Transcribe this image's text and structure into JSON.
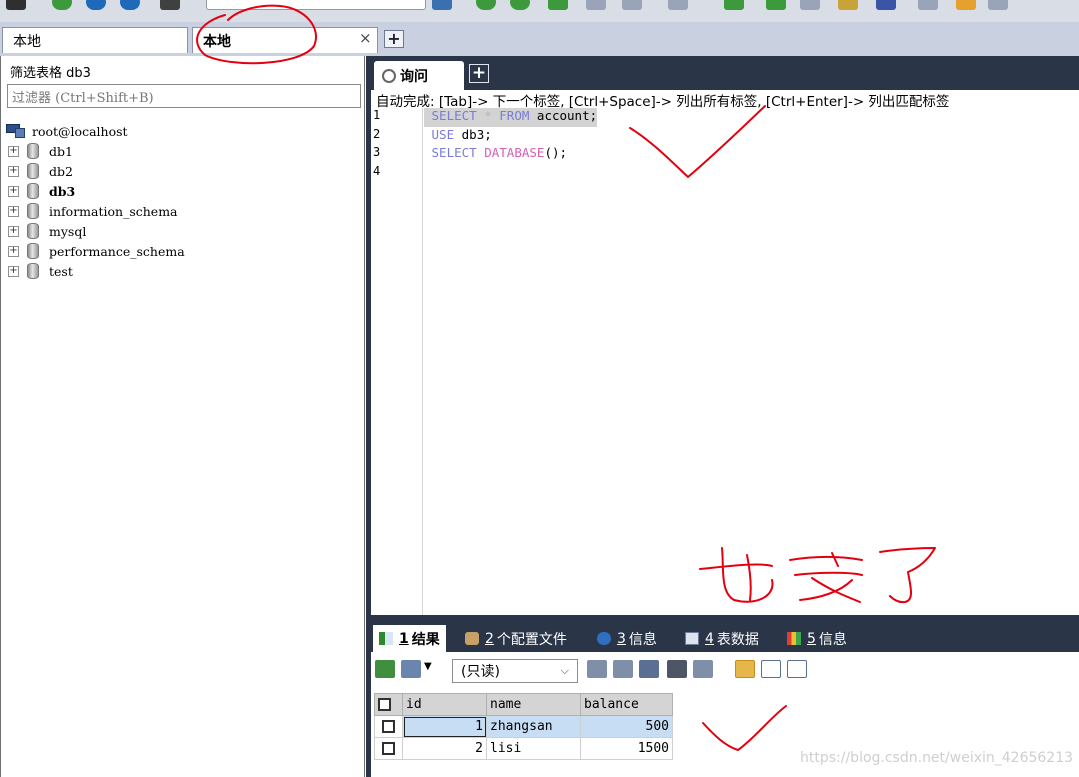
{
  "conn_tabs": [
    {
      "label": "本地"
    },
    {
      "label": "本地"
    }
  ],
  "tab_close": "×",
  "tab_add": "+",
  "left_panel": {
    "filter_title": "筛选表格 db3",
    "filter_placeholder": "过滤器 (Ctrl+Shift+B)",
    "root": "root@localhost",
    "databases": [
      {
        "name": "db1"
      },
      {
        "name": "db2"
      },
      {
        "name": "db3",
        "selected": true
      },
      {
        "name": "information_schema"
      },
      {
        "name": "mysql"
      },
      {
        "name": "performance_schema"
      },
      {
        "name": "test"
      }
    ]
  },
  "query": {
    "tab_label": "询问",
    "add": "+",
    "autocomplete_hint": "自动完成: [Tab]-> 下一个标签, [Ctrl+Space]-> 列出所有标签, [Ctrl+Enter]-> 列出匹配标签",
    "line_numbers": [
      "1",
      "2",
      "3",
      "4"
    ],
    "lines": [
      {
        "kw1": "SELECT",
        "op": "*",
        "kw2": "FROM",
        "rest": "account;"
      },
      {
        "kw1": "USE",
        "rest": "db3;"
      },
      {
        "kw1": "SELECT",
        "fn": "DATABASE",
        "rest": "();"
      }
    ]
  },
  "result_tabs": [
    {
      "num": "1",
      "label": "结果"
    },
    {
      "num": "2",
      "label": "个配置文件"
    },
    {
      "num": "3",
      "label": "信息"
    },
    {
      "num": "4",
      "label": "表数据"
    },
    {
      "num": "5",
      "label": "信息"
    }
  ],
  "result": {
    "readonly_option": "(只读)",
    "columns": [
      "id",
      "name",
      "balance"
    ],
    "rows": [
      {
        "id": "1",
        "name": "zhangsan",
        "balance": "500"
      },
      {
        "id": "2",
        "name": "lisi",
        "balance": "1500"
      }
    ]
  },
  "watermark": "https://blog.csdn.net/weixin_42656213",
  "annotation": {
    "color": "#e3000f"
  }
}
